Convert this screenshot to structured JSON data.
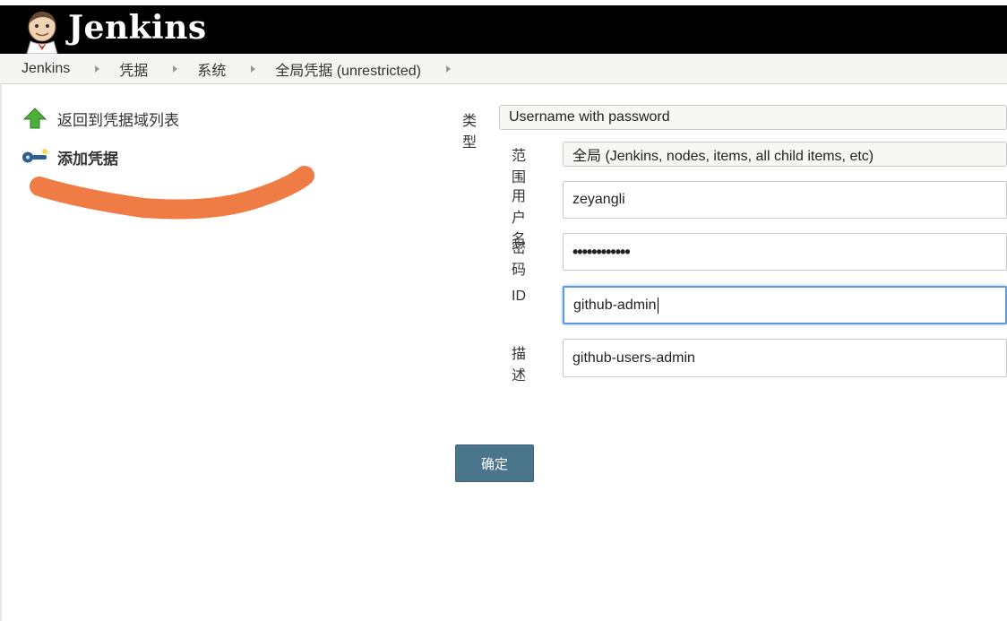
{
  "header": {
    "brand": "Jenkins",
    "logo_icon": "jenkins-butler-icon"
  },
  "breadcrumb": [
    {
      "label": "Jenkins"
    },
    {
      "label": "凭据"
    },
    {
      "label": "系统"
    },
    {
      "label": "全局凭据 (unrestricted)"
    }
  ],
  "sidebar": {
    "back_label": "返回到凭据域列表",
    "back_icon": "up-arrow-icon",
    "add_label": "添加凭据",
    "add_icon": "credential-key-icon"
  },
  "form": {
    "kind_label": "类型",
    "kind_value": "Username with password",
    "scope_label": "范围",
    "scope_value": "全局 (Jenkins, nodes, items, all child items, etc)",
    "username_label": "用户名",
    "username_value": "zeyangli",
    "password_label": "密码",
    "password_value": "••••••••••••",
    "id_label": "ID",
    "id_value": "github-admin",
    "description_label": "描述",
    "description_value": "github-users-admin",
    "ok_label": "确定"
  },
  "colors": {
    "topbar": "#000000",
    "ok_button": "#4b758b",
    "focus_border": "#5d9be0",
    "scribble": "#f07c45"
  }
}
